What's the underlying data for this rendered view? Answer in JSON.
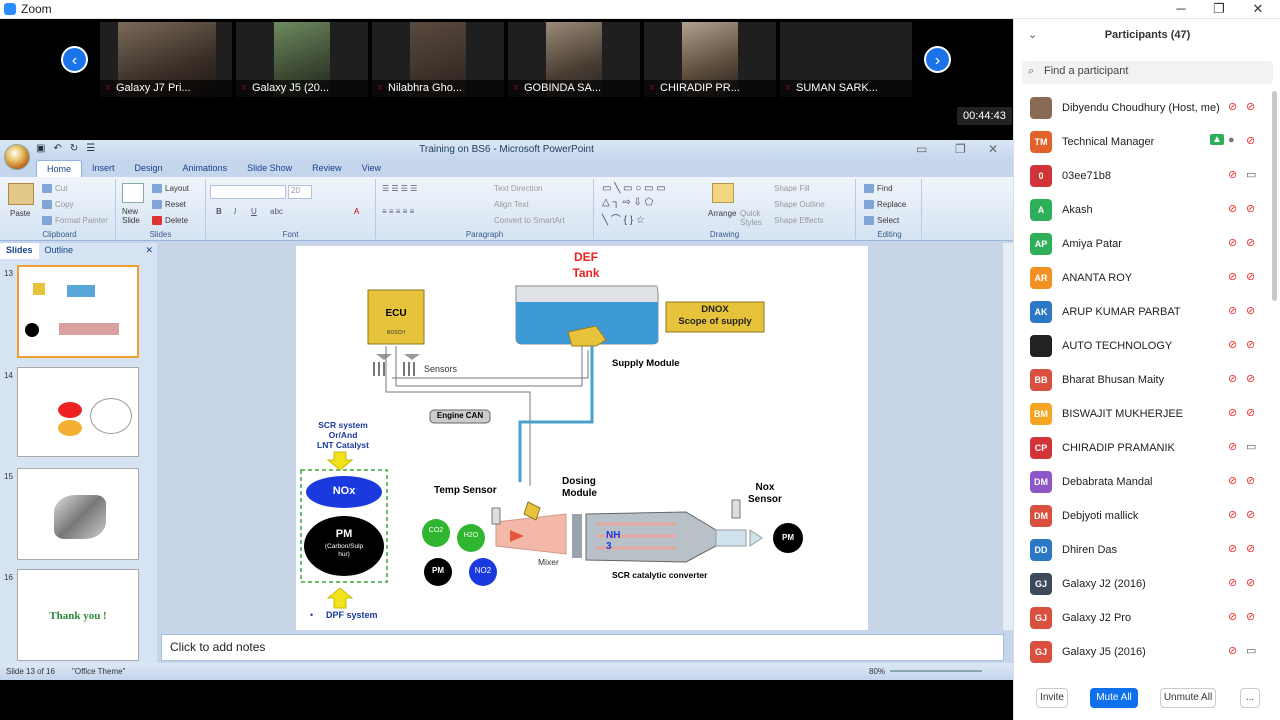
{
  "window": {
    "title": "Zoom",
    "minimize": "─",
    "maximize": "❐",
    "close": "✕"
  },
  "stage": {
    "tiles": [
      "Galaxy J7 Pri...",
      "Galaxy J5 (20...",
      "Nilabhra Gho...",
      "GOBINDA SA...",
      "CHIRADIP PR...",
      "SUMAN SARK..."
    ],
    "prev": "‹",
    "next": "›",
    "timer": "00:44:43"
  },
  "ppt": {
    "title": "Training on BS6 - Microsoft PowerPoint",
    "tabs": [
      "Home",
      "Insert",
      "Design",
      "Animations",
      "Slide Show",
      "Review",
      "View"
    ],
    "groups": {
      "clipboard": "Clipboard",
      "slides": "Slides",
      "font": "Font",
      "paragraph": "Paragraph",
      "drawing": "Drawing",
      "editing": "Editing"
    },
    "buttons": {
      "paste": "Paste",
      "cut": "Cut",
      "copy": "Copy",
      "format_painter": "Format Painter",
      "new_slide": "New Slide",
      "layout": "Layout",
      "reset": "Reset",
      "delete": "Delete",
      "text_direction": "Text Direction",
      "align_text": "Align Text",
      "convert_smartart": "Convert to SmartArt",
      "arrange": "Arrange",
      "quick_styles": "Quick Styles",
      "shape_fill": "Shape Fill",
      "shape_outline": "Shape Outline",
      "shape_effects": "Shape Effects",
      "find": "Find",
      "replace": "Replace",
      "select": "Select",
      "font_size": "20"
    },
    "slides_tab": "Slides",
    "outline_tab": "Outline",
    "thumbs": [
      "13",
      "14",
      "15",
      "16"
    ],
    "thumb_text": {
      "t16": "Thank you !"
    },
    "notes": "Click to add notes",
    "status_left": "Slide 13 of 16",
    "status_theme": "\"Office Theme\"",
    "zoom": "80%"
  },
  "slide": {
    "def_tank": [
      "DEF",
      "Tank"
    ],
    "ecu": "ECU",
    "bosch": "BOSCH",
    "sensors": "Sensors",
    "dnox": [
      "DNOX",
      "Scope of supply"
    ],
    "supply_module": "Supply Module",
    "engine_can": "Engine CAN",
    "scr_label": [
      "SCR system",
      "Or/And",
      "LNT Catalyst"
    ],
    "nox": "NOx",
    "pm_big": "PM",
    "pm_sub": [
      "(Carbon/Sulp",
      "hur)"
    ],
    "dpf": "DPF system",
    "temp_sensor": "Temp Sensor",
    "dosing": [
      "Dosing",
      "Module"
    ],
    "nox_sensor": [
      "Nox",
      "Sensor"
    ],
    "co2": "CO2",
    "h2o": "H2O",
    "pm_small": "PM",
    "no2": "NO2",
    "mixer": "Mixer",
    "nh3": [
      "NH",
      "3"
    ],
    "scr_conv": "SCR catalytic converter",
    "pm_out": "PM",
    "bullet": "•"
  },
  "panel": {
    "title": "Participants (47)",
    "search_placeholder": "Find a participant",
    "participants": [
      {
        "initials": "",
        "name": "Dibyendu Choudhury (Host, me)",
        "color": "#8a6a55",
        "video": "off"
      },
      {
        "initials": "TM",
        "name": "Technical Manager",
        "color": "#e2622c",
        "video": "share"
      },
      {
        "initials": "0",
        "name": "03ee71b8",
        "color": "#d13438",
        "video": "cam"
      },
      {
        "initials": "A",
        "name": "Akash",
        "color": "#2eaf5a",
        "video": "off"
      },
      {
        "initials": "AP",
        "name": "Amiya Patar",
        "color": "#2eaf5a",
        "video": "off"
      },
      {
        "initials": "AR",
        "name": "ANANTA ROY",
        "color": "#f39024",
        "video": "off"
      },
      {
        "initials": "AK",
        "name": "ARUP KUMAR PARBAT",
        "color": "#2b78c5",
        "video": "off"
      },
      {
        "initials": "",
        "name": "AUTO TECHNOLOGY",
        "color": "#222222",
        "video": "off"
      },
      {
        "initials": "BB",
        "name": "Bharat Bhusan Maity",
        "color": "#d9503f",
        "video": "off"
      },
      {
        "initials": "BM",
        "name": "BISWAJIT MUKHERJEE",
        "color": "#f3a523",
        "video": "off"
      },
      {
        "initials": "CP",
        "name": "CHIRADIP PRAMANIK",
        "color": "#d13438",
        "video": "cam"
      },
      {
        "initials": "DM",
        "name": "Debabrata Mandal",
        "color": "#8e57c9",
        "video": "off"
      },
      {
        "initials": "DM",
        "name": "Debjyoti mallick",
        "color": "#d9503f",
        "video": "off"
      },
      {
        "initials": "DD",
        "name": "Dhiren Das",
        "color": "#2b78c5",
        "video": "off"
      },
      {
        "initials": "GJ",
        "name": "Galaxy J2 (2016)",
        "color": "#3d4a5c",
        "video": "off"
      },
      {
        "initials": "GJ",
        "name": "Galaxy J2 Pro",
        "color": "#d9503f",
        "video": "off"
      },
      {
        "initials": "GJ",
        "name": "Galaxy J5 (2016)",
        "color": "#d9503f",
        "video": "cam"
      }
    ],
    "invite": "Invite",
    "mute_all": "Mute All",
    "unmute_all": "Unmute All",
    "more": "..."
  }
}
